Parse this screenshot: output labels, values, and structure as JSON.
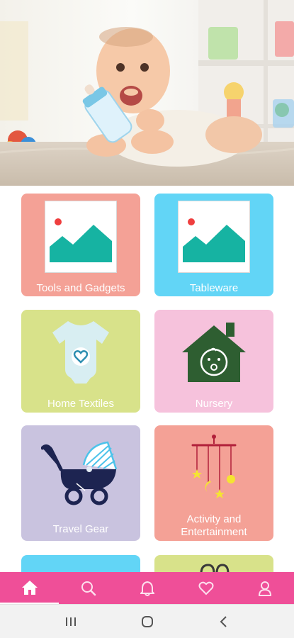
{
  "hero": {
    "image": "baby-with-bottle-photo"
  },
  "categories": [
    {
      "label": "Tools and Gadgets",
      "color": "#f4a196",
      "icon": "image-placeholder-icon"
    },
    {
      "label": "Tableware",
      "color": "#62d5f6",
      "icon": "image-placeholder-icon"
    },
    {
      "label": "Home Textiles",
      "color": "#d8e28a",
      "icon": "baby-onesie-icon"
    },
    {
      "label": "Nursery",
      "color": "#f6c2dc",
      "icon": "baby-house-icon"
    },
    {
      "label": "Travel Gear",
      "color": "#c9c3df",
      "icon": "stroller-icon"
    },
    {
      "label": "Activity and Entertainment",
      "color": "#f4a196",
      "icon": "baby-mobile-icon"
    }
  ],
  "partial_cards": [
    {
      "color": "#62d5f6"
    },
    {
      "color": "#d8e28a"
    }
  ],
  "bottom_nav": [
    {
      "name": "home",
      "icon": "home-icon",
      "active": true
    },
    {
      "name": "search",
      "icon": "search-icon",
      "active": false
    },
    {
      "name": "notifications",
      "icon": "bell-icon",
      "active": false
    },
    {
      "name": "favorites",
      "icon": "heart-icon",
      "active": false
    },
    {
      "name": "profile",
      "icon": "user-icon",
      "active": false
    }
  ],
  "system_nav": [
    {
      "name": "recents",
      "icon": "recents-icon"
    },
    {
      "name": "home",
      "icon": "circle-home-icon"
    },
    {
      "name": "back",
      "icon": "back-chevron-icon"
    }
  ],
  "colors": {
    "accent": "#ef4f98",
    "nav_bar": "#f2f2f2"
  }
}
